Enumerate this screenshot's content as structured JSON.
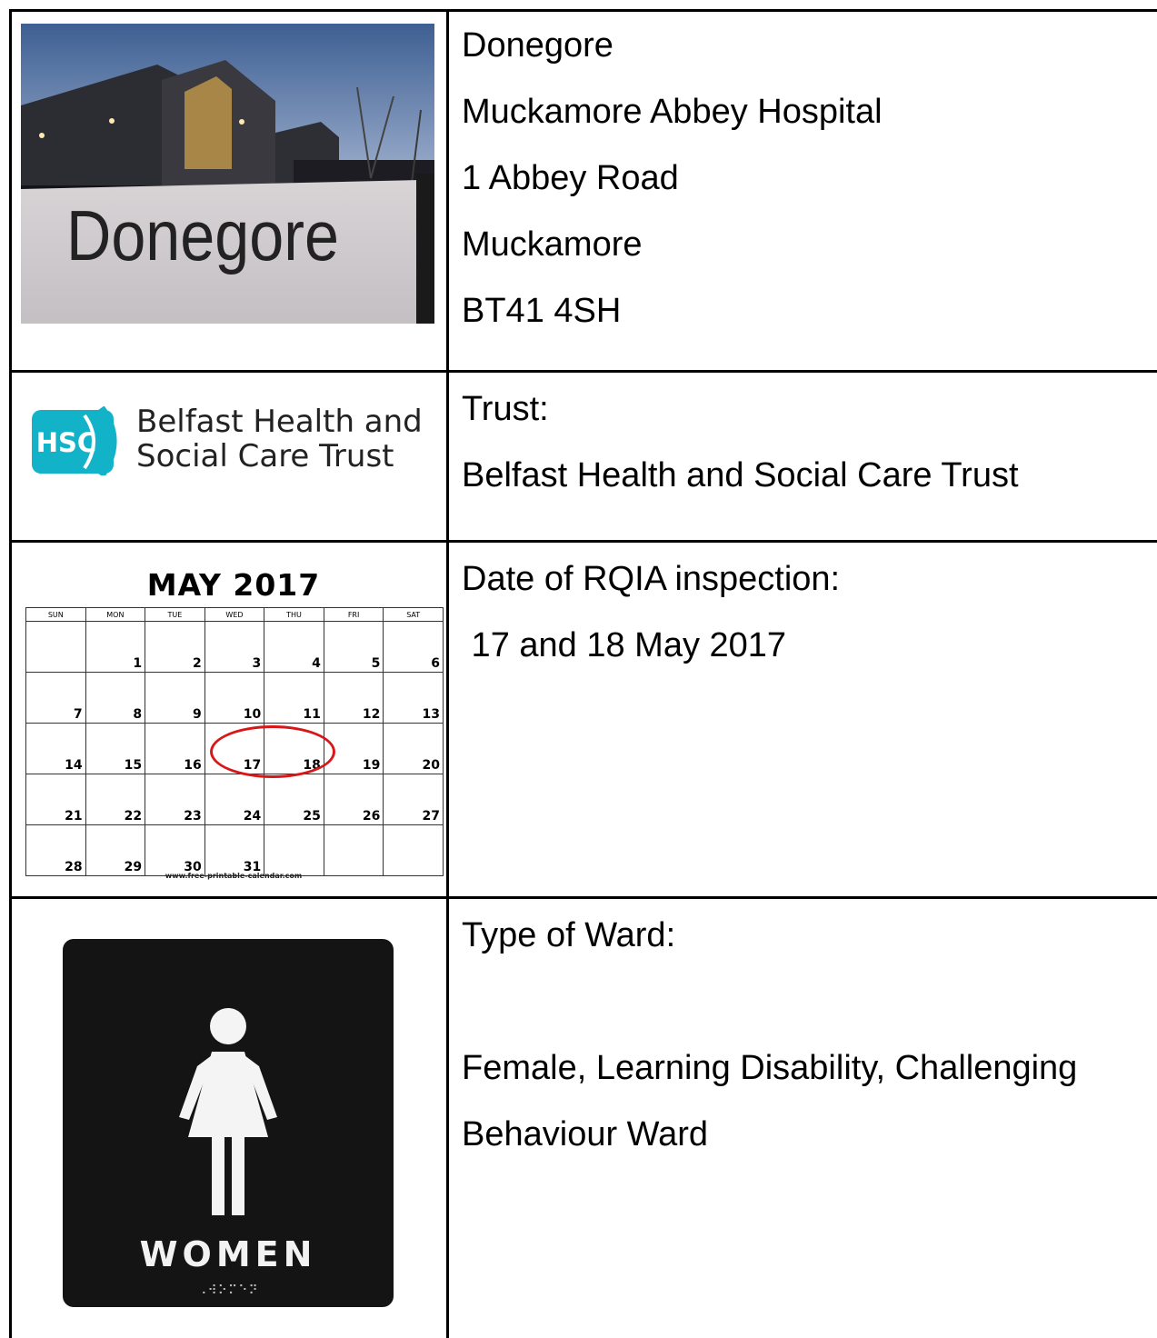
{
  "rows": [
    {
      "image": {
        "sign_text": "Donegore"
      },
      "lines": [
        "Donegore",
        "Muckamore Abbey Hospital",
        "1 Abbey Road",
        "Muckamore",
        "BT41 4SH"
      ]
    },
    {
      "image": {
        "logo_badge": "HSC",
        "logo_line1": "Belfast Health and",
        "logo_line2": "Social Care Trust"
      },
      "lines": [
        "Trust:",
        "Belfast Health and Social Care Trust"
      ]
    },
    {
      "image": {
        "calendar_title": "MAY 2017",
        "weekdays": [
          "SUN",
          "MON",
          "TUE",
          "WED",
          "THU",
          "FRI",
          "SAT"
        ],
        "weeks": [
          [
            "",
            "1",
            "2",
            "3",
            "4",
            "5",
            "6"
          ],
          [
            "7",
            "8",
            "9",
            "10",
            "11",
            "12",
            "13"
          ],
          [
            "14",
            "15",
            "16",
            "17",
            "18",
            "19",
            "20"
          ],
          [
            "21",
            "22",
            "23",
            "24",
            "25",
            "26",
            "27"
          ],
          [
            "28",
            "29",
            "30",
            "31",
            "",
            "",
            ""
          ]
        ],
        "circled_days": [
          "17",
          "18"
        ],
        "footer": "www.free-printable-calendar.com",
        "circle_color": "#d81818"
      },
      "lines": [
        "Date of RQIA inspection:",
        " 17 and 18 May 2017"
      ]
    },
    {
      "image": {
        "sign_word": "WOMEN",
        "braille": "⠠⠺⠕⠍⠑⠝"
      },
      "lines": [
        "Type of Ward:",
        "",
        "Female, Learning Disability, Challenging",
        "Behaviour Ward"
      ]
    }
  ]
}
